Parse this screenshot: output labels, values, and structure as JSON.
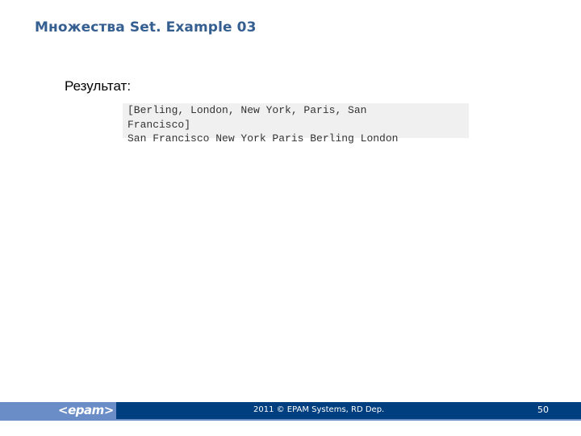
{
  "slide": {
    "title": "Множества Set. Example 03",
    "result_label": "Результат:",
    "code_output": "[Berling, London, New York, Paris, San Francisco]\nSan Francisco New York Paris Berling London"
  },
  "footer": {
    "logo": "<epam>",
    "copyright": "2011 © EPAM Systems, RD Dep.",
    "page_number": "50",
    "colors": {
      "band_dark": "#003f7f",
      "band_light": "#6a8cc7",
      "title": "#365f91"
    }
  }
}
